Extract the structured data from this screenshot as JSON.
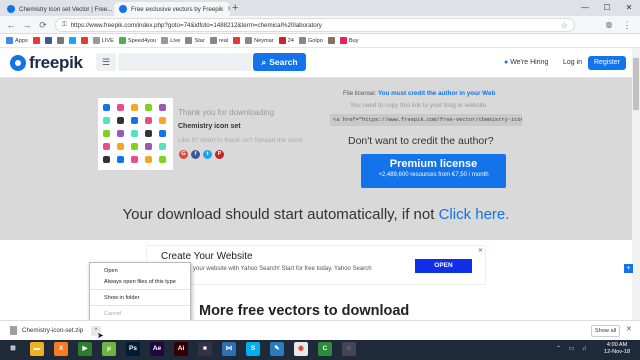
{
  "tabs": [
    {
      "title": "Chemistry Icon set Vector | Free...",
      "active": false,
      "favicon_color": "#1273eb"
    },
    {
      "title": "Free exclusive vectors by Freepik",
      "active": true,
      "favicon_color": "#1273eb"
    }
  ],
  "window_controls": {
    "minimize": "—",
    "maximize": "☐",
    "close": "✕"
  },
  "address_bar": {
    "url": "https://www.freepik.com/index.php?goto=74&idfoto=1488212&term=chemical%20laboratory",
    "back_icon": "←",
    "forward_icon": "→",
    "reload_icon": "⟳",
    "lock_icon": "🔒",
    "star_icon": "☆"
  },
  "bookmarks": [
    {
      "label": "Apps",
      "color": "#4285f4"
    },
    {
      "label": "",
      "color": "#e53935"
    },
    {
      "label": "",
      "color": "#3b5998"
    },
    {
      "label": "",
      "color": "#777"
    },
    {
      "label": "",
      "color": "#1da1f2"
    },
    {
      "label": "",
      "color": "#e53935"
    },
    {
      "label": "LIVE",
      "color": "#999"
    },
    {
      "label": "Speed4you",
      "color": "#4caf50"
    },
    {
      "label": "Live",
      "color": "#999"
    },
    {
      "label": "Star",
      "color": "#888"
    },
    {
      "label": "real",
      "color": "#888"
    },
    {
      "label": "",
      "color": "#e53935"
    },
    {
      "label": "Neymar",
      "color": "#888"
    },
    {
      "label": "24",
      "color": "#c62828"
    },
    {
      "label": "Golpo",
      "color": "#888"
    },
    {
      "label": "",
      "color": "#8d6e63"
    },
    {
      "label": "Buy",
      "color": "#e91e63"
    }
  ],
  "header": {
    "logo_text": "freepik",
    "menu_icon": "☰",
    "search_placeholder": "",
    "search_label": "Search",
    "search_icon": "⌕",
    "hiring_label": "We're Hiring",
    "login_label": "Log in",
    "register_label": "Register"
  },
  "download": {
    "thanks": "Thank you for downloading",
    "filename": "Chemistry icon set",
    "likeit": "Like it? Want to thank us? Spread the word",
    "share_buttons": [
      {
        "label": "G",
        "color": "#dd4b39"
      },
      {
        "label": "f",
        "color": "#3b5998"
      },
      {
        "label": "t",
        "color": "#1da1f2"
      },
      {
        "label": "P",
        "color": "#cb2027"
      }
    ],
    "license_prefix": "File license:",
    "license_bold": "You must credit the author in your Web",
    "license_sub": "You need to copy this link to your blog or website",
    "attribution_code": "<a href=\"https://www.freepik.com/free-vector/chemistry-icon-set",
    "dont_want": "Don't want to credit the author?",
    "premium_title": "Premium license",
    "premium_sub": "+2,489,600 resources from €7,50 / month",
    "auto_text": "Your download should start automatically, if not",
    "click_here": "Click here."
  },
  "ad": {
    "title": "Create Your Website",
    "text": "Easily build your website with Yahoo Search! Start for free today. Yahoo Search",
    "open_label": "OPEN",
    "close_icon": "✕"
  },
  "more_title": "More free vectors to download",
  "context_menu": {
    "items": [
      "Open",
      "Always open files of this type",
      "Show in folder",
      "Cancel"
    ]
  },
  "download_bar": {
    "file": "Chemistry-icon-set.zip",
    "caret": "^",
    "show_all": "Show all",
    "close_icon": "✕"
  },
  "taskbar": {
    "apps": [
      {
        "name": "start",
        "glyph": "⊞",
        "color": "#1e2a3a"
      },
      {
        "name": "file-explorer",
        "glyph": "▬",
        "color": "#f2b01e"
      },
      {
        "name": "xampp",
        "glyph": "X",
        "color": "#fb7a24"
      },
      {
        "name": "media",
        "glyph": "▶",
        "color": "#2c7d2c"
      },
      {
        "name": "torrent",
        "glyph": "μ",
        "color": "#6fb543"
      },
      {
        "name": "photoshop",
        "glyph": "Ps",
        "color": "#001d34"
      },
      {
        "name": "after-effects",
        "glyph": "Ae",
        "color": "#1f0740"
      },
      {
        "name": "illustrator",
        "glyph": "Ai",
        "color": "#330000"
      },
      {
        "name": "app",
        "glyph": "■",
        "color": "#334"
      },
      {
        "name": "share",
        "glyph": "⋈",
        "color": "#2d6fb5"
      },
      {
        "name": "skype",
        "glyph": "S",
        "color": "#00aff0"
      },
      {
        "name": "notepad",
        "glyph": "✎",
        "color": "#2a7bbf"
      },
      {
        "name": "browser",
        "glyph": "◉",
        "color": "#e8e8e8"
      },
      {
        "name": "camtasia",
        "glyph": "C",
        "color": "#2e8b3a"
      },
      {
        "name": "app2",
        "glyph": "◌",
        "color": "#445"
      }
    ],
    "time": "4:00 AM",
    "date": "12-Nov-18",
    "tray": "⌃ ▭ ♫"
  }
}
